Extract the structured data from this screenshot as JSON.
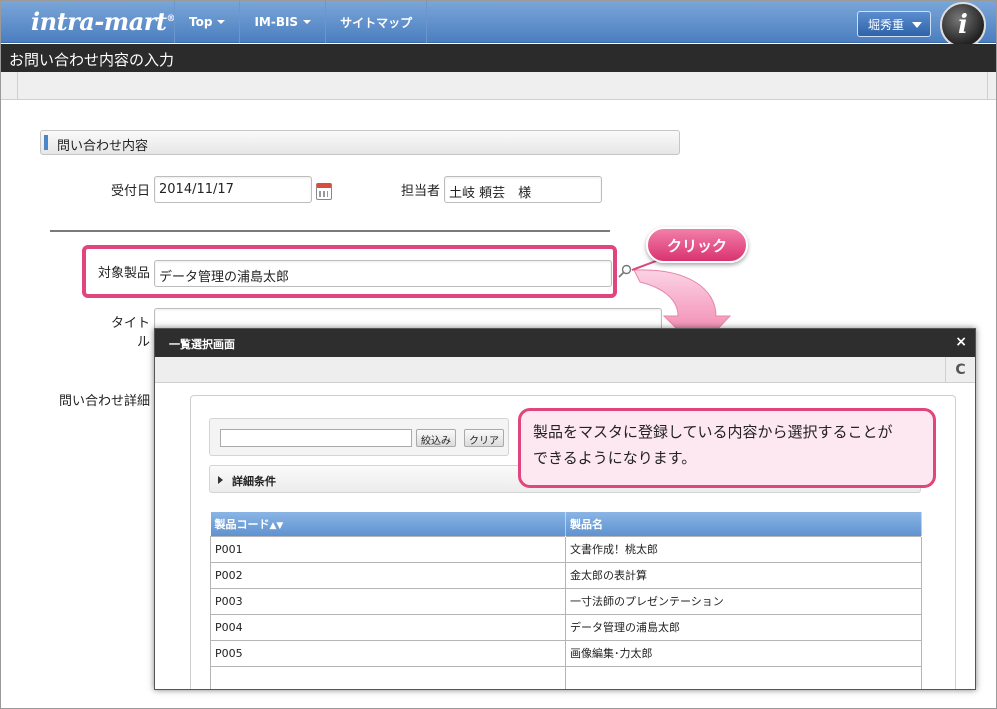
{
  "app": {
    "logo_text": "intra-mart",
    "nav_items": [
      {
        "label": "Top",
        "has_caret": true
      },
      {
        "label": "IM-BIS",
        "has_caret": true
      },
      {
        "label": "サイトマップ",
        "has_caret": false
      }
    ],
    "user_name": "堀秀重",
    "avatar_letter": "i"
  },
  "page": {
    "title": "お問い合わせ内容の入力"
  },
  "form": {
    "section_title": "問い合わせ内容",
    "received_date_label": "受付日",
    "received_date_value": "2014/11/17",
    "assignee_label": "担当者",
    "assignee_value": "土岐 頼芸　様",
    "product_label": "対象製品",
    "product_value": "データ管理の浦島太郎",
    "title_label": "タイトル",
    "detail_label": "問い合わせ詳細"
  },
  "annotations": {
    "click_badge": "クリック",
    "callout_line1": "製品をマスタに登録している内容から選択することが",
    "callout_line2": "できるようになります。",
    "accent_color": "#e0457e"
  },
  "dialog": {
    "title": "一覧選択画面",
    "close_label": "×",
    "refresh_label": "C",
    "filter_button": "絞込み",
    "clear_button": "クリア",
    "detail_conditions": "詳細条件",
    "columns": [
      "製品コード",
      "製品名"
    ],
    "rows": [
      {
        "code": "P001",
        "name": "文書作成！桃太郎"
      },
      {
        "code": "P002",
        "name": "金太郎の表計算"
      },
      {
        "code": "P003",
        "name": "一寸法師のプレゼンテーション"
      },
      {
        "code": "P004",
        "name": "データ管理の浦島太郎"
      },
      {
        "code": "P005",
        "name": "画像編集･力太郎"
      }
    ]
  }
}
